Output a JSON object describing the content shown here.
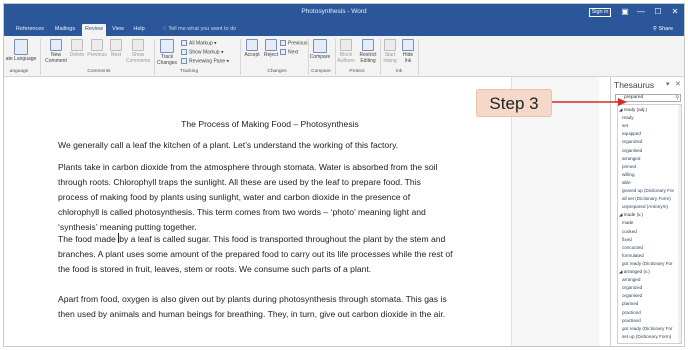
{
  "window": {
    "title": "Photosynthesis - Word",
    "sign_in": "Sign in",
    "min": "—",
    "max": "☐",
    "close": "✕",
    "share": "Share"
  },
  "tabs": [
    {
      "label": "References",
      "active": false
    },
    {
      "label": "Mailings",
      "active": false
    },
    {
      "label": "Review",
      "active": true
    },
    {
      "label": "View",
      "active": false
    },
    {
      "label": "Help",
      "active": false
    }
  ],
  "tell_me": "Tell me what you want to do",
  "ribbon": {
    "language": "ate Language",
    "new_comment": "New Comment",
    "delete": "Delete",
    "previous": "Previous",
    "next": "Next",
    "show_comments": "Show Comments",
    "track_changes": "Track Changes",
    "all_markup": "All Markup",
    "show_markup": "Show Markup",
    "reviewing_pane": "Reviewing Pane",
    "accept": "Accept",
    "reject": "Reject",
    "previous2": "Previous",
    "next2": "Next",
    "compare": "Compare",
    "block_authors": "Block Authors",
    "restrict_editing": "Restrict Editing",
    "start_inking": "Start Inking",
    "hide_ink": "Hide Ink",
    "groups": {
      "language": "anguage",
      "comments": "Comments",
      "tracking": "Tracking",
      "changes": "Changes",
      "compare": "Compare",
      "protect": "Protect",
      "ink": "Ink"
    }
  },
  "document": {
    "title": "The Process of Making Food – Photosynthesis",
    "p1": "We generally call a leaf the kitchen of a plant. Let’s understand the working of this factory.",
    "p2": "Plants take in carbon dioxide from the atmosphere through stomata. Water is absorbed from the soil through roots. Chlorophyll traps the sunlight. All these are used by the leaf to prepare food. This process of making food by plants using sunlight, water and carbon dioxide in the presence of chlorophyll is called photosynthesis. This term comes from two words – ‘photo’ meaning light and ‘synthesis’ meaning putting together.",
    "p3a": "The food made ",
    "p3b": "by a leaf is called sugar. This food is transported throughout the plant by the stem and branches. A plant uses some amount of the prepared food to carry out its life processes while the rest of the food is stored in fruit, leaves, stem or roots. We consume such parts of a plant.",
    "p4": "Apart from food, oxygen is also given out by plants during photosynthesis through stomata. This gas is then used by animals and human beings for breathing. They, in turn, give out carbon dioxide in the air."
  },
  "thesaurus": {
    "title": "Thesaurus",
    "dropdown": "▾",
    "close": "✕",
    "search_value": "prepared",
    "items": [
      {
        "text": "◢ ready (adj.)",
        "hdr": true
      },
      {
        "text": "ready",
        "hdr": false
      },
      {
        "text": "set",
        "hdr": false
      },
      {
        "text": "equipped",
        "hdr": false
      },
      {
        "text": "organized",
        "hdr": false
      },
      {
        "text": "organised",
        "hdr": false
      },
      {
        "text": "arranged",
        "hdr": false
      },
      {
        "text": "primed",
        "hdr": false
      },
      {
        "text": "willing",
        "hdr": false
      },
      {
        "text": "able",
        "hdr": false
      },
      {
        "text": "geared up (Dictionary For",
        "hdr": false
      },
      {
        "text": "all set (Dictionary Form)",
        "hdr": false
      },
      {
        "text": "unprepared (Antonym)",
        "hdr": false
      },
      {
        "text": "◢ made (v.)",
        "hdr": true
      },
      {
        "text": "made",
        "hdr": false
      },
      {
        "text": "cooked",
        "hdr": false
      },
      {
        "text": "fixed",
        "hdr": false
      },
      {
        "text": "concocted",
        "hdr": false
      },
      {
        "text": "formulated",
        "hdr": false
      },
      {
        "text": "got ready (Dictionary For",
        "hdr": false
      },
      {
        "text": "◢ arranged (v.)",
        "hdr": true
      },
      {
        "text": "arranged",
        "hdr": false
      },
      {
        "text": "organized",
        "hdr": false
      },
      {
        "text": "organised",
        "hdr": false
      },
      {
        "text": "planned",
        "hdr": false
      },
      {
        "text": "practiced",
        "hdr": false
      },
      {
        "text": "practised",
        "hdr": false
      },
      {
        "text": "got ready (Dictionary For",
        "hdr": false
      },
      {
        "text": "set up (Dictionary Form)",
        "hdr": false
      }
    ]
  },
  "callout": {
    "label": "Step 3",
    "color": "#d62b2b"
  }
}
